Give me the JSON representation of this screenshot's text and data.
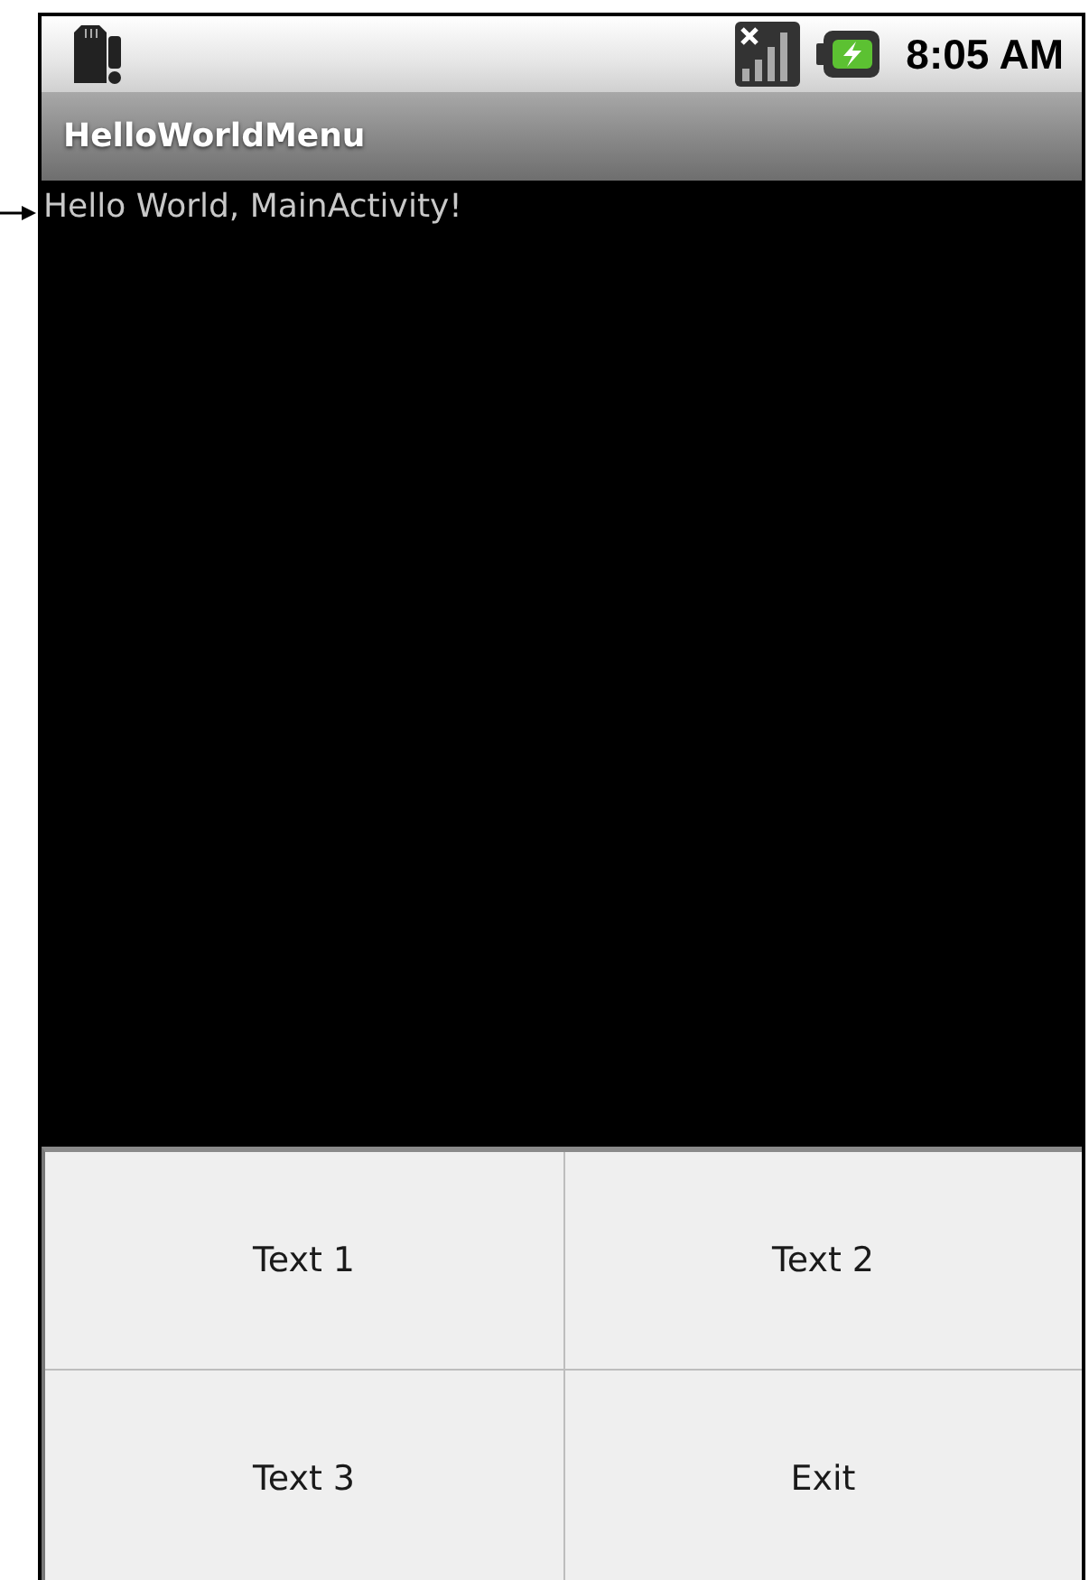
{
  "status_bar": {
    "time": "8:05 AM"
  },
  "title_bar": {
    "title": "HelloWorldMenu"
  },
  "content": {
    "text": "Hello World, MainActivity!"
  },
  "menu": {
    "items": [
      {
        "label": "Text 1"
      },
      {
        "label": "Text 2"
      },
      {
        "label": "Text 3"
      },
      {
        "label": "Exit"
      }
    ]
  }
}
